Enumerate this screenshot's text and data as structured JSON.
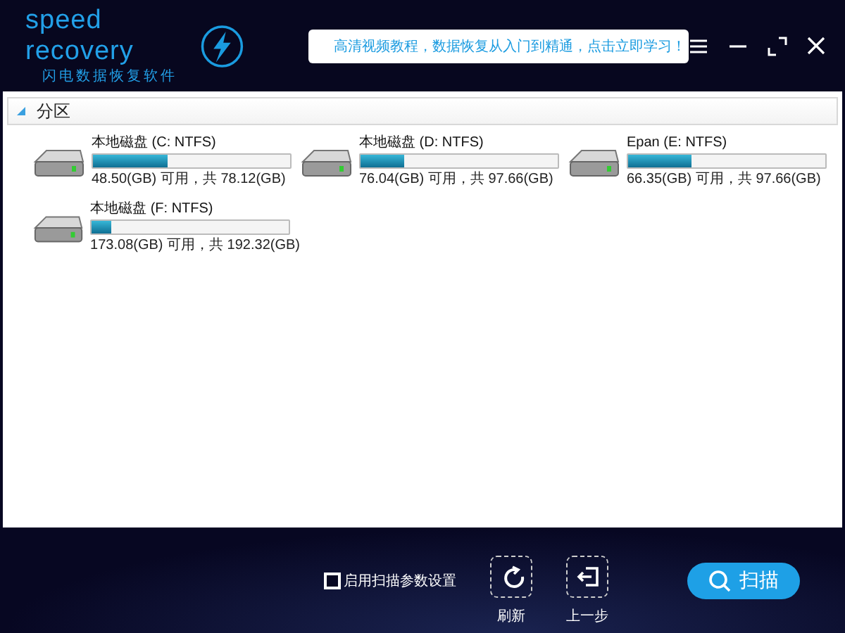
{
  "app": {
    "logo_title": "speed recovery",
    "logo_subtitle": "闪电数据恢复软件"
  },
  "notice": {
    "text": "高清视频教程，数据恢复从入门到精通，点击立即学习！"
  },
  "section": {
    "title": "分区",
    "expanded": true
  },
  "drives": [
    {
      "name": "本地磁盘 (C: NTFS)",
      "level": 0.38,
      "usage": "48.50(GB) 可用，共 78.12(GB)"
    },
    {
      "name": "本地磁盘 (D: NTFS)",
      "level": 0.22,
      "usage": "76.04(GB) 可用，共 97.66(GB)"
    },
    {
      "name": "Epan (E: NTFS)",
      "level": 0.32,
      "usage": "66.35(GB) 可用，共 97.66(GB)"
    },
    {
      "name": "本地磁盘 (F: NTFS)",
      "level": 0.1,
      "usage": "173.08(GB) 可用，共 192.32(GB)"
    }
  ],
  "footer": {
    "scan_settings": {
      "label": "启用扫描参数设置",
      "checked": false
    },
    "buttons": [
      {
        "kind": "refresh",
        "label": "刷新"
      },
      {
        "kind": "back",
        "label": "上一步"
      }
    ],
    "scan_button": "扫描"
  }
}
